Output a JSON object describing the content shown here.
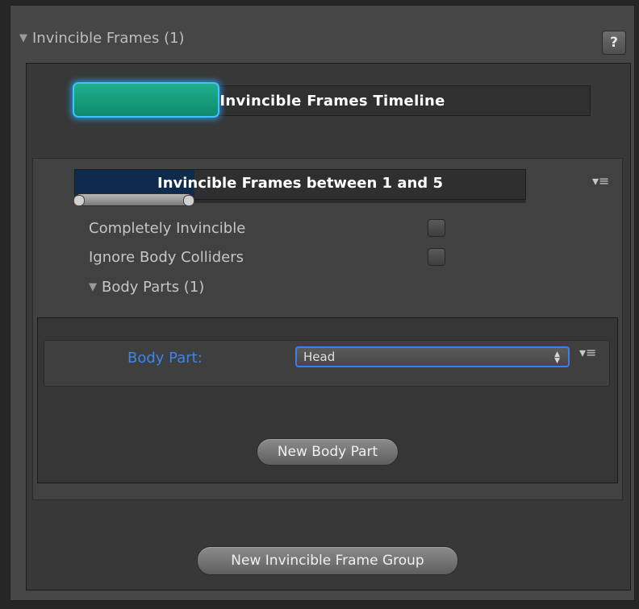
{
  "foldout": {
    "title": "Invincible Frames (1)",
    "expanded": true
  },
  "help": {
    "label": "?"
  },
  "timeline": {
    "label": "Invincible Frames Timeline",
    "accent_color": "#1fb08e",
    "glow_color": "#3ec3ff"
  },
  "group": {
    "range_label": "Invincible Frames between 1 and 5",
    "range_fill_color": "#0e2a4c",
    "menu_icon": "menu-icon",
    "properties": [
      {
        "label": "Completely Invincible",
        "checked": false
      },
      {
        "label": "Ignore Body Colliders",
        "checked": false
      }
    ],
    "body_parts_foldout": "Body Parts (1)",
    "body_part": {
      "label": "Body Part:",
      "label_color": "#3b86e8",
      "value": "Head"
    },
    "new_body_part_label": "New Body Part"
  },
  "new_group_label": "New Invincible Frame Group"
}
